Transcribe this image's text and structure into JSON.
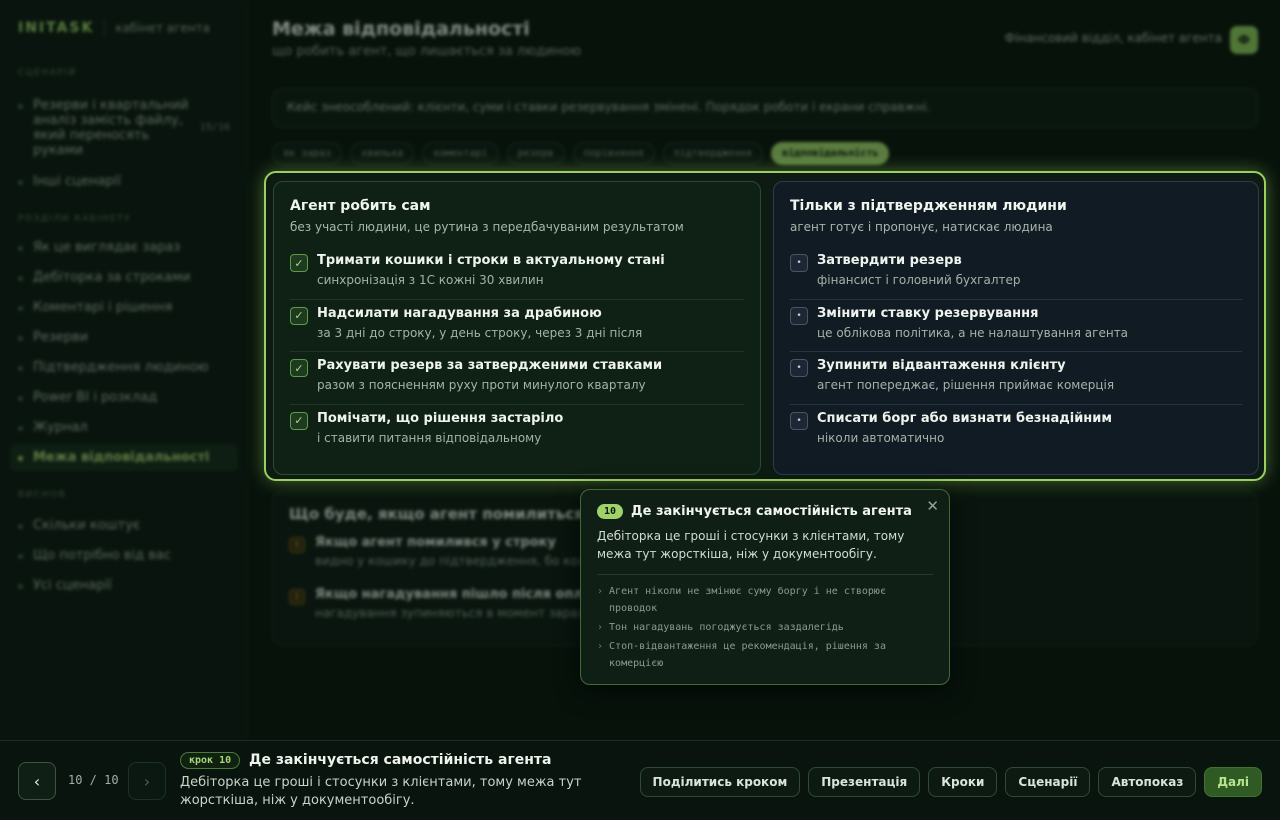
{
  "brand": {
    "logo": "INITASK",
    "subtitle": "кабінет агента"
  },
  "sidebar": {
    "sections": [
      {
        "title": "СЦЕНАРІЙ"
      },
      {
        "title": "РОЗДІЛИ КАБІНЕТУ"
      },
      {
        "title": "ВИСНОВ"
      }
    ],
    "scenario_items": [
      {
        "label": "Резерви і квартальний аналіз замість файлу, який переносять руками",
        "count": "15/16"
      },
      {
        "label": "Інші сценарії"
      }
    ],
    "cabinet_items": [
      {
        "label": "Як це виглядає зараз"
      },
      {
        "label": "Дебіторка за строками"
      },
      {
        "label": "Коментарі і рішення"
      },
      {
        "label": "Резерви"
      },
      {
        "label": "Підтвердження людиною"
      },
      {
        "label": "Power BI і розклад"
      },
      {
        "label": "Журнал"
      },
      {
        "label": "Межа відповідальності"
      }
    ],
    "conclusion_items": [
      {
        "label": "Скільки коштує"
      },
      {
        "label": "Що потрібно від вас"
      },
      {
        "label": "Усі сценарії"
      }
    ]
  },
  "header": {
    "title": "Межа відповідальності",
    "subtitle": "що робить агент, що лишається за людиною",
    "department": "Фінансовий відділ, кабінет агента",
    "avatar": "Ф"
  },
  "notice": "Кейс знеособлений: клієнти, суми і ставки резервування змінені. Порядок роботи і екрани справжні.",
  "pills": [
    "як зараз",
    "хвилька",
    "коментарі",
    "резерв",
    "порівняння",
    "підтвердження",
    "відповідальність"
  ],
  "agent_alone": {
    "title": "Агент робить сам",
    "subtitle": "без участі людини, це рутина з передбачуваним результатом",
    "items": [
      {
        "title": "Тримати кошики і строки в актуальному стані",
        "sub": "синхронізація з 1С кожні 30 хвилин"
      },
      {
        "title": "Надсилати нагадування за драбиною",
        "sub": "за 3 дні до строку, у день строку, через 3 дні після"
      },
      {
        "title": "Рахувати резерв за затвердженими ставками",
        "sub": "разом з поясненням руху проти минулого кварталу"
      },
      {
        "title": "Помічати, що рішення застаріло",
        "sub": "і ставити питання відповідальному"
      }
    ]
  },
  "human_confirm": {
    "title": "Тільки з підтвердженням людини",
    "subtitle": "агент готує і пропонує, натискає людина",
    "items": [
      {
        "title": "Затвердити резерв",
        "sub": "фінансист і головний бухгалтер"
      },
      {
        "title": "Змінити ставку резервування",
        "sub": "це облікова політика, а не налаштування агента"
      },
      {
        "title": "Зупинити відвантаження клієнту",
        "sub": "агент попереджає, рішення приймає комерція"
      },
      {
        "title": "Списати борг або визнати безнадійним",
        "sub": "ніколи автоматично"
      }
    ]
  },
  "mistakes": {
    "title": "Що буде, якщо агент помилиться",
    "items": [
      {
        "title": "Якщо агент помилився у строку",
        "sub": "видно у кошику до підтвердження, бо кожен..."
      },
      {
        "title": "Якщо нагадування пішло після оплати",
        "sub": "нагадування зупиняються в момент зарахування..."
      }
    ]
  },
  "popover": {
    "number": "10",
    "title": "Де закінчується самостійність агента",
    "text": "Дебіторка це гроші і стосунки з клієнтами, тому межа тут жорсткіша, ніж у документообігу.",
    "points": [
      "Агент ніколи не змінює суму боргу і не створює проводок",
      "Тон нагадувань погоджується заздалегідь",
      "Стоп-відвантаження це рекомендація, рішення за комерцією"
    ]
  },
  "bottom": {
    "counter": "10 / 10",
    "step_badge": "крок 10",
    "step_title": "Де закінчується самостійність агента",
    "step_desc": "Дебіторка це гроші і стосунки з клієнтами, тому межа тут жорсткіша, ніж у документообігу.",
    "buttons": {
      "share": "Поділитись кроком",
      "presentation": "Презентація",
      "steps": "Кроки",
      "scenarios": "Сценарії",
      "autoplay": "Автопоказ",
      "next": "Далі"
    }
  },
  "colors": {
    "accent": "#9fd36a",
    "background": "#07120b",
    "warning": "#e2b64a"
  }
}
